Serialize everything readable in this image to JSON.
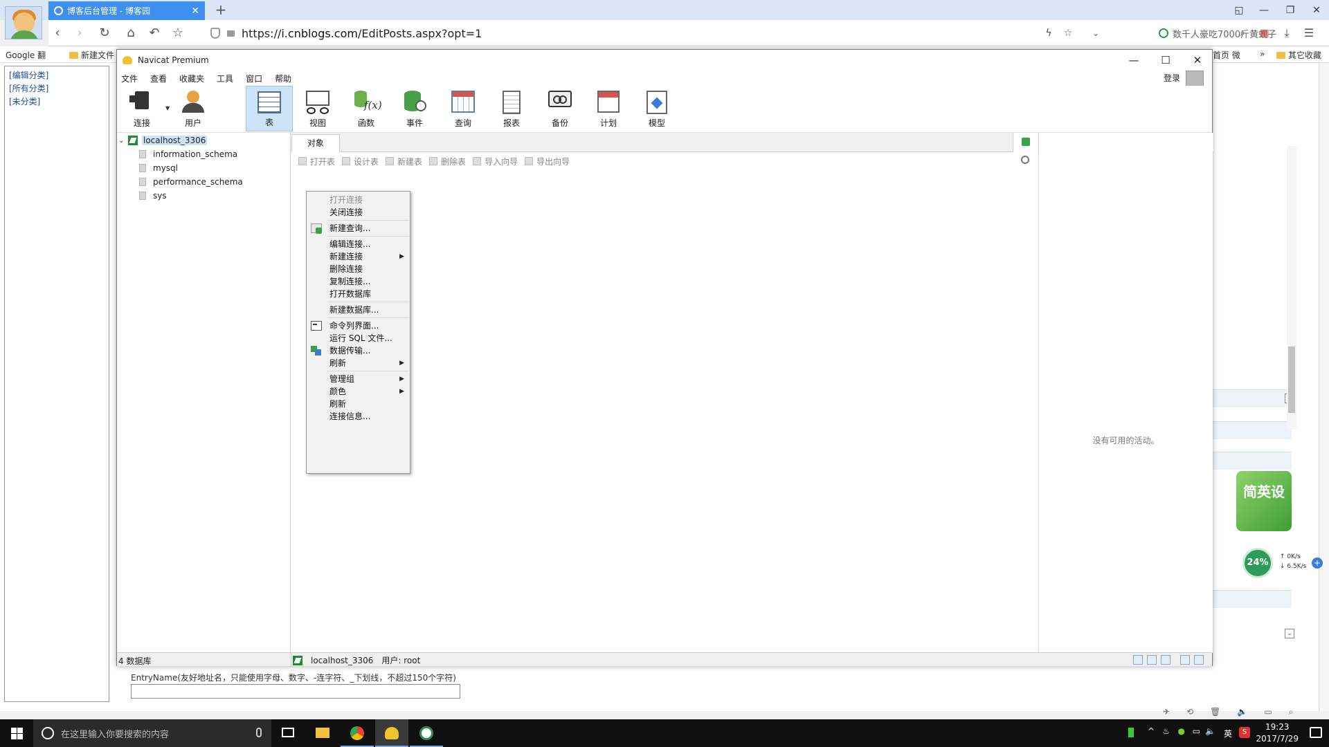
{
  "browser": {
    "tab_title": "博客后台管理 - 博客园",
    "tab_close": "✕",
    "new_tab": "+",
    "url_prefix": "https://",
    "url_domain": "i.cnblogs.com",
    "url_path": "/EditPosts.aspx?opt=1",
    "search_placeholder": "数千人豪吃7000斤黄蚬子",
    "bookmarks": [
      "Google 翻",
      "新建文件",
      "首页 微",
      "»",
      "其它收藏"
    ]
  },
  "webpage": {
    "nav_links": [
      "[编辑分类]",
      "[所有分类]",
      "[未分类]"
    ],
    "entry_label": "EntryName(友好地址名，只能使用字母、数字、-连字符、_下划线，不超过150个字符)",
    "badge_text": "简英设",
    "speed_percent": "24%",
    "upload_speed": "0K/s",
    "download_speed": "6.5K/s"
  },
  "navicat": {
    "title": "Navicat Premium",
    "menu": [
      "文件",
      "查看",
      "收藏夹",
      "工具",
      "窗口",
      "帮助"
    ],
    "login": "登录",
    "toolbar": [
      "连接",
      "用户",
      "表",
      "视图",
      "函数",
      "事件",
      "查询",
      "报表",
      "备份",
      "计划",
      "模型"
    ],
    "connection": "localhost_3306",
    "databases": [
      "information_schema",
      "mysql",
      "performance_schema",
      "sys"
    ],
    "object_tab": "对象",
    "object_tools": [
      "打开表",
      "设计表",
      "新建表",
      "删除表",
      "导入向导",
      "导出向导"
    ],
    "no_activity": "没有可用的活动。",
    "status_db_count": "4 数据库",
    "status_connection": "localhost_3306",
    "status_user": "用户: root"
  },
  "context_menu": {
    "items": [
      {
        "label": "打开连接",
        "disabled": true
      },
      {
        "label": "关闭连接"
      },
      {
        "label": "新建查询..."
      },
      {
        "label": "编辑连接..."
      },
      {
        "label": "新建连接",
        "submenu": true
      },
      {
        "label": "删除连接"
      },
      {
        "label": "复制连接..."
      },
      {
        "label": "打开数据库"
      },
      {
        "label": "新建数据库..."
      },
      {
        "label": "命令列界面..."
      },
      {
        "label": "运行 SQL 文件..."
      },
      {
        "label": "数据传输..."
      },
      {
        "label": "刷新",
        "submenu": true
      },
      {
        "label": "管理组",
        "submenu": true
      },
      {
        "label": "颜色",
        "submenu": true
      },
      {
        "label": "刷新"
      },
      {
        "label": "连接信息..."
      }
    ]
  },
  "taskbar": {
    "search_placeholder": "在这里输入你要搜索的内容",
    "ime": "英",
    "time": "19:23",
    "date": "2017/7/29"
  },
  "colors": {
    "tab_active": "#3d8ff0",
    "toolbar_active": "#cde3f7",
    "taskbar": "#101010"
  }
}
